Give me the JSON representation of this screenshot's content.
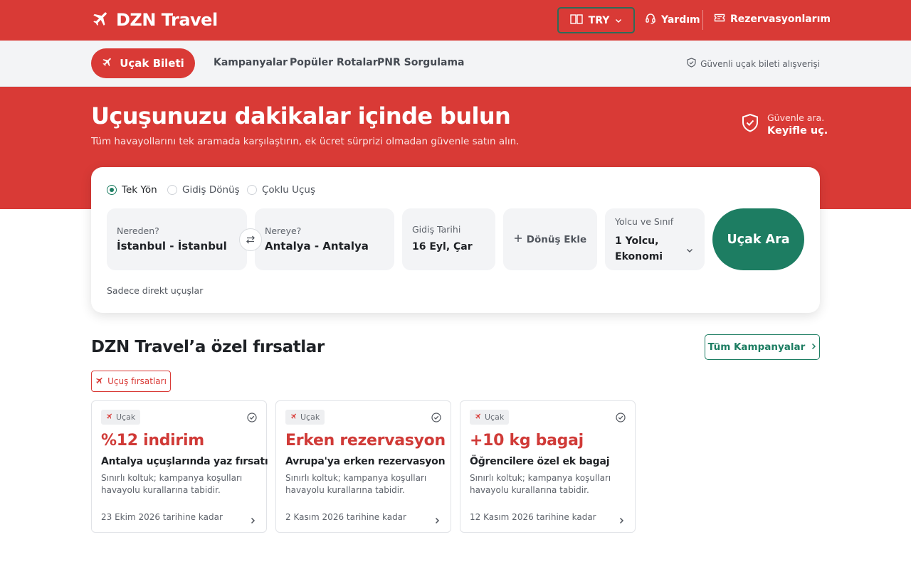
{
  "header": {
    "brand": "DZN Travel",
    "currency": "TRY",
    "help": "Yardım",
    "reservations": "Rezervasyonlarım"
  },
  "subnav": {
    "active": "Uçak Bileti",
    "links": [
      "Kampanyalar",
      "Popüler Rotalar",
      "PNR Sorgulama"
    ],
    "secure": "Güvenli uçak bileti alışverişi"
  },
  "hero": {
    "title": "Uçuşunuzu dakikalar içinde bulun",
    "subtitle": "Tüm havayollarını tek aramada karşılaştırın, ek ücret sürprizi olmadan güvenle satın alın.",
    "trust_small": "Güvenle ara.",
    "trust_big": "Keyifle uç."
  },
  "search": {
    "trip_types": [
      "Tek Yön",
      "Gidiş Dönüş",
      "Çoklu Uçuş"
    ],
    "selected_trip": "Tek Yön",
    "from_label": "Nereden?",
    "from_value": "İstanbul - İstanbul",
    "to_label": "Nereye?",
    "to_value": "Antalya - Antalya",
    "date_label": "Gidiş Tarihi",
    "date_value": "16 Eyl, Çar",
    "return_label": "Dönüş Ekle",
    "pax_label": "Yolcu ve Sınıf",
    "pax_line1": "1 Yolcu,",
    "pax_line2": "Ekonomi",
    "button": "Uçak Ara",
    "direct": "Sadece direkt uçuşlar"
  },
  "deals": {
    "title": "DZN Travel’a özel fırsatlar",
    "all_button": "Tüm Kampanyalar",
    "chip": "Uçuş fırsatları",
    "cards": [
      {
        "tag": "Uçak",
        "title": "%12 indirim",
        "subtitle": "Antalya uçuşlarında yaz fırsatı",
        "desc": "Sınırlı koltuk; kampanya koşulları havayolu kurallarına tabidir.",
        "date": "23 Ekim 2026 tarihine kadar"
      },
      {
        "tag": "Uçak",
        "title": "Erken rezervasyon",
        "subtitle": "Avrupa'ya erken rezervasyon",
        "desc": "Sınırlı koltuk; kampanya koşulları havayolu kurallarına tabidir.",
        "date": "2 Kasım 2026 tarihine kadar"
      },
      {
        "tag": "Uçak",
        "title": "+10 kg bagaj",
        "subtitle": "Öğrencilere özel ek bagaj",
        "desc": "Sınırlı koltuk; kampanya koşulları havayolu kurallarına tabidir.",
        "date": "12 Kasım 2026 tarihine kadar"
      }
    ]
  },
  "colors": {
    "brand": "#d93a36",
    "accent": "#1d7d62"
  }
}
